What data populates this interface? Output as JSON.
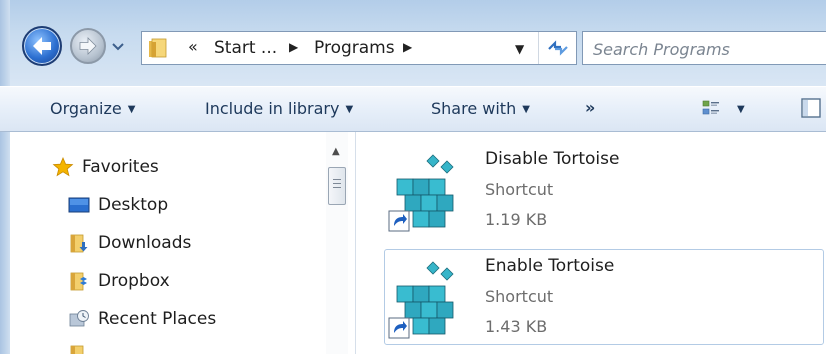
{
  "address_bar": {
    "overflow_glyph": "«",
    "crumbs": [
      "Start ...",
      "Programs"
    ]
  },
  "search": {
    "placeholder": "Search Programs",
    "value": ""
  },
  "command_bar": {
    "organize": "Organize",
    "include_in_library": "Include in library",
    "share_with": "Share with",
    "more": "»"
  },
  "nav_pane": {
    "items": [
      {
        "label": "Favorites",
        "icon": "star-icon"
      },
      {
        "label": "Desktop",
        "icon": "desktop-icon"
      },
      {
        "label": "Downloads",
        "icon": "downloads-folder-icon"
      },
      {
        "label": "Dropbox",
        "icon": "dropbox-folder-icon"
      },
      {
        "label": "Recent Places",
        "icon": "recent-places-icon"
      }
    ]
  },
  "files": [
    {
      "name": "Disable Tortoise",
      "type": "Shortcut",
      "size": "1.19 KB",
      "icon": "registry-shortcut-icon",
      "selected": false
    },
    {
      "name": "Enable Tortoise",
      "type": "Shortcut",
      "size": "1.43 KB",
      "icon": "registry-shortcut-icon",
      "selected": true
    }
  ],
  "colors": {
    "accent": "#2c6fd0",
    "command_text": "#1e395b",
    "selection_border": "#b3cbe5",
    "secondary_text": "#6d6d6d"
  }
}
